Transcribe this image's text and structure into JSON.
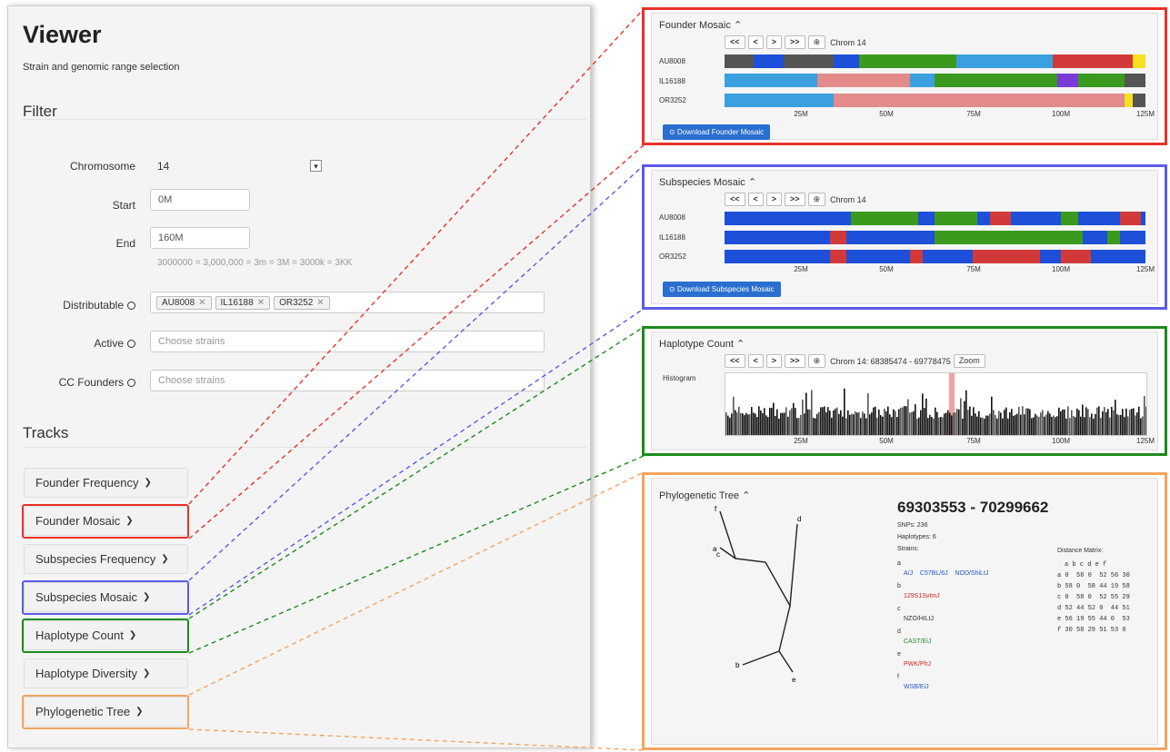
{
  "viewer": {
    "title": "Viewer",
    "subtitle": "Strain and genomic range selection",
    "filter_heading": "Filter",
    "tracks_heading": "Tracks",
    "chromosome_label": "Chromosome",
    "chromosome_value": "14",
    "start_label": "Start",
    "start_value": "0M",
    "end_label": "End",
    "end_value": "160M",
    "range_hint": "3000000 = 3,000,000 = 3m = 3M = 3000k = 3KK",
    "distributable_label": "Distributable",
    "distributable_tags": [
      "AU8008",
      "IL16188",
      "OR3252"
    ],
    "active_label": "Active",
    "active_placeholder": "Choose strains",
    "cc_label": "CC Founders",
    "cc_placeholder": "Choose strains",
    "tracks": [
      "Founder Frequency",
      "Founder Mosaic",
      "Subspecies Frequency",
      "Subspecies Mosaic",
      "Haplotype Count",
      "Haplotype Diversity",
      "Phylogenetic Tree"
    ]
  },
  "colors": {
    "red": "#e8322a",
    "blue": "#5b5be8",
    "green": "#1d8a1d",
    "orange": "#f3a55f",
    "button_blue": "#2a6fcf"
  },
  "nav": {
    "first": "<<",
    "prev": "<",
    "next": ">",
    "last": ">>",
    "zoom_icon": "magnifier-icon"
  },
  "founder_mosaic": {
    "title": "Founder Mosaic",
    "chrom_text": "Chrom 14",
    "strains": [
      "AU8008",
      "IL16188",
      "OR3252"
    ],
    "ticks": [
      "25M",
      "50M",
      "75M",
      "100M",
      "125M"
    ],
    "download_label": "Download Founder Mosaic"
  },
  "subspecies_mosaic": {
    "title": "Subspecies Mosaic",
    "chrom_text": "Chrom 14",
    "strains": [
      "AU8008",
      "IL16188",
      "OR3252"
    ],
    "ticks": [
      "25M",
      "50M",
      "75M",
      "100M",
      "125M"
    ],
    "download_label": "Download Subspecies Mosaic"
  },
  "haplotype_count": {
    "title": "Haplotype Count",
    "chrom_text": "Chrom 14: 68385474 - 69778475",
    "zoom_label": "Zoom",
    "histogram_label": "Histogram",
    "ticks": [
      "25M",
      "50M",
      "75M",
      "100M",
      "125M"
    ]
  },
  "phylo": {
    "title": "Phylogenetic Tree",
    "range": "69303553 - 70299662",
    "snps": "SNPs: 236",
    "haplotypes": "Haplotypes: 6",
    "strains_label": "Strains:",
    "groups": [
      {
        "key": "a",
        "strains": [
          "A/J",
          "C57BL/6J",
          "NOD/ShiLtJ"
        ],
        "color": "#2255cc"
      },
      {
        "key": "b",
        "strains": [
          "129S1SvImJ"
        ],
        "color": "#cc2222"
      },
      {
        "key": "c",
        "strains": [
          "NZO/HILtJ"
        ],
        "color": "#333333"
      },
      {
        "key": "d",
        "strains": [
          "CAST/EiJ"
        ],
        "color": "#22882a"
      },
      {
        "key": "e",
        "strains": [
          "PWK/PhJ"
        ],
        "color": "#cc2222"
      },
      {
        "key": "f",
        "strains": [
          "WSB/EiJ"
        ],
        "color": "#2255cc"
      }
    ],
    "leaf_labels": [
      "a",
      "b",
      "c",
      "d",
      "e",
      "f"
    ],
    "distance_matrix_label": "Distance Matrix:",
    "distance_matrix": [
      "a b c d e f",
      "a 0  58 0  52 56 30",
      "b 58 0  58 44 19 58",
      "c 0  58 0  52 55 29",
      "d 52 44 52 0  44 51",
      "e 56 19 55 44 0  53",
      "f 30 58 29 51 53 0"
    ]
  }
}
